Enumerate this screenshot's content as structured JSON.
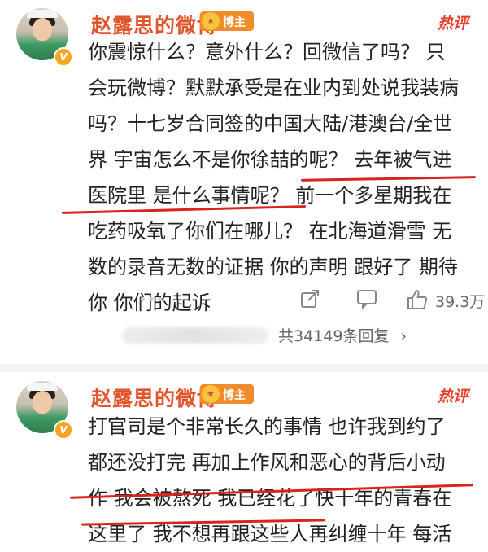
{
  "comment1": {
    "username": "赵露思的微博",
    "rank_badge": "博主",
    "hot_tag": "热评",
    "lines": [
      "你震惊什么？意外什么？回微信了吗？ 只",
      "会玩微博？默默承受是在业内到处说我装病",
      "吗？十七岁合同签的中国大陆/港澳台/全世",
      "界  宇宙怎么不是你徐喆的呢？ 去年被气进",
      "医院里 是什么事情呢？ 前一个多星期我在",
      "吃药吸氧了你们在哪儿？ 在北海道滑雪  无",
      "数的录音无数的证据 你的声明 跟好了 期待",
      "你 你们的起诉"
    ],
    "like_count": "39.3万",
    "reply_count": "共34149条回复",
    "reply_chevron": "›",
    "icons": [
      "more-icon",
      "share-icon",
      "comment-icon",
      "like-icon"
    ]
  },
  "comment2": {
    "username": "赵露思的微博",
    "rank_badge": "博主",
    "hot_tag": "热评",
    "lines": [
      "打官司是个非常长久的事情 也许我到约了",
      "都还没打完  再加上作风和恶心的背后小动",
      "作  我会被熬死  我已经花了快十年的青春在",
      "这里了  我不想再跟这些人再纠缠十年  每活"
    ]
  },
  "colors": {
    "username": "#e0552b",
    "hot": "#e8412a",
    "underline": "#d8231f",
    "badge": "#f08c2a"
  }
}
